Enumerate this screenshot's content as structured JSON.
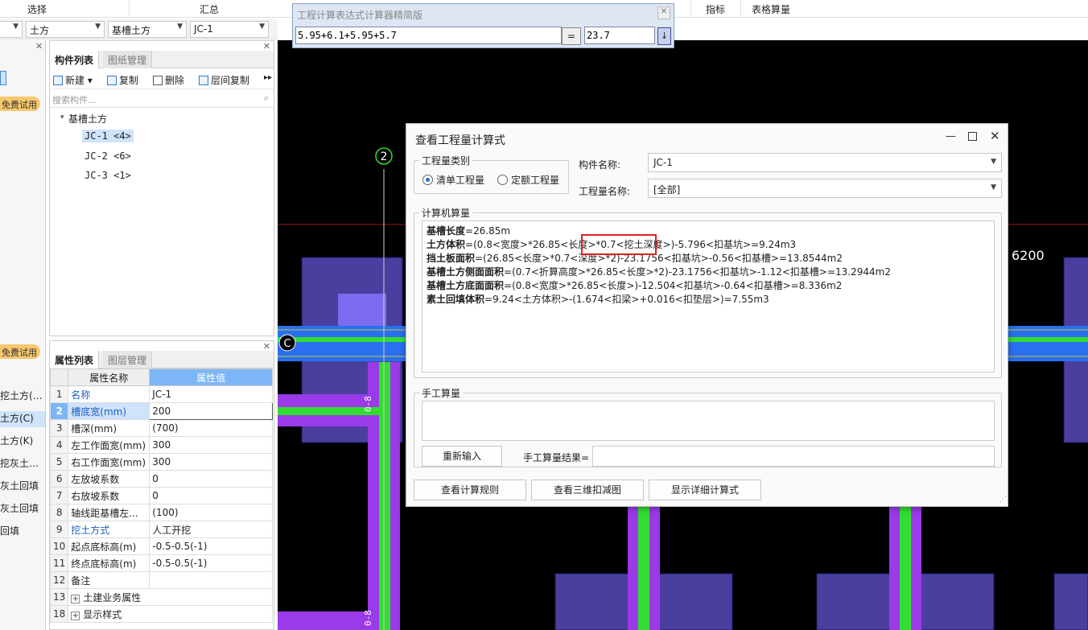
{
  "ribbon": {
    "select": "选择",
    "summary": "汇总",
    "indicator": "指标",
    "table_calc": "表格算量"
  },
  "filters": {
    "soil": "土方",
    "type": "基槽土方",
    "item": "JC-1"
  },
  "left_strip": {
    "trial_label": "免费试用",
    "items": [
      "挖土方(…",
      "土方(C)",
      "土方(K)",
      "挖灰土…",
      "灰土回填",
      "灰土回填",
      "回填"
    ]
  },
  "component_panel": {
    "tabs": [
      "构件列表",
      "图纸管理"
    ],
    "toolbar": {
      "new": "新建",
      "copy": "复制",
      "delete": "删除",
      "floor_copy": "层间复制"
    },
    "search_placeholder": "搜索构件...",
    "tree_root": "基槽土方",
    "tree_items": [
      "JC-1 <4>",
      "JC-2 <6>",
      "JC-3 <1>"
    ]
  },
  "property_panel": {
    "tabs": [
      "属性列表",
      "图层管理"
    ],
    "header_name": "属性名称",
    "header_value": "属性值",
    "rows": [
      {
        "n": "1",
        "name": "名称",
        "value": "JC-1"
      },
      {
        "n": "2",
        "name": "槽底宽(mm)",
        "value": "200"
      },
      {
        "n": "3",
        "name": "槽深(mm)",
        "value": "(700)"
      },
      {
        "n": "4",
        "name": "左工作面宽(mm)",
        "value": "300"
      },
      {
        "n": "5",
        "name": "右工作面宽(mm)",
        "value": "300"
      },
      {
        "n": "6",
        "name": "左放坡系数",
        "value": "0"
      },
      {
        "n": "7",
        "name": "右放坡系数",
        "value": "0"
      },
      {
        "n": "8",
        "name": "轴线距基槽左...",
        "value": "(100)"
      },
      {
        "n": "9",
        "name": "挖土方式",
        "value": "人工开挖"
      },
      {
        "n": "10",
        "name": "起点底标高(m)",
        "value": "-0.5-0.5(-1)"
      },
      {
        "n": "11",
        "name": "终点底标高(m)",
        "value": "-0.5-0.5(-1)"
      },
      {
        "n": "12",
        "name": "备注",
        "value": ""
      },
      {
        "n": "13",
        "name": "土建业务属性",
        "value": ""
      },
      {
        "n": "18",
        "name": "显示样式",
        "value": ""
      }
    ]
  },
  "calculator": {
    "title": "工程计算表达式计算器精简版",
    "expression": "5.95+6.1+5.95+5.7",
    "equals": "=",
    "result": "23.7"
  },
  "canvas": {
    "axis_number": "2",
    "axis_letter": "C",
    "dimension": "6200",
    "label_a": "0-8",
    "label_b": "0-8"
  },
  "dialog": {
    "title": "查看工程量计算式",
    "category_label": "工程量类别",
    "radio_list": "清单工程量",
    "radio_quota": "定额工程量",
    "component_name_label": "构件名称:",
    "component_name": "JC-1",
    "quantity_name_label": "工程量名称:",
    "quantity_name": "[全部]",
    "computer_calc_label": "计算机算量",
    "formulas": [
      {
        "name": "基槽长度",
        "expr": "=26.85m"
      },
      {
        "name": "土方体积",
        "expr": "=(0.8<宽度>*26.85<长度>*0.7<挖土深度>)-5.796<扣基坑>=9.24m3"
      },
      {
        "name": "挡土板面积",
        "expr": "=(26.85<长度>*0.7<深度>*2)-23.1756<扣基坑>-0.56<扣基槽>=13.8544m2"
      },
      {
        "name": "基槽土方侧面面积",
        "expr": "=(0.7<折算高度>*26.85<长度>*2)-23.1756<扣基坑>-1.12<扣基槽>=13.2944m2"
      },
      {
        "name": "基槽土方底面面积",
        "expr": "=(0.8<宽度>*26.85<长度>)-12.504<扣基坑>-0.64<扣基槽>=8.336m2"
      },
      {
        "name": "素土回填体积",
        "expr": "=9.24<土方体积>-(1.674<扣梁>+0.016<扣垫层>)=7.55m3"
      }
    ],
    "manual_calc_label": "手工算量",
    "reenter": "重新输入",
    "manual_result_label": "手工算量结果=",
    "btn_rules": "查看计算规则",
    "btn_3d": "查看三维扣减图",
    "btn_detail": "显示详细计算式"
  }
}
